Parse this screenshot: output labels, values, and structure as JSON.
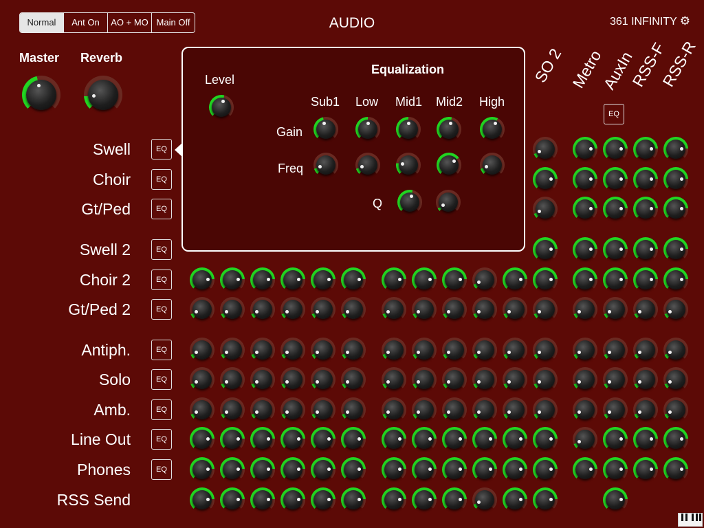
{
  "header": {
    "modes": [
      {
        "label": "Normal",
        "active": true
      },
      {
        "label": "Ant On",
        "active": false
      },
      {
        "label": "AO + MO",
        "active": false
      },
      {
        "label": "Main Off",
        "active": false
      }
    ],
    "title": "AUDIO",
    "device": "361 INFINITY",
    "settings_icon": "gear-icon"
  },
  "master": {
    "label": "Master"
  },
  "reverb": {
    "label": "Reverb"
  },
  "eq_label": "EQ",
  "rows": [
    {
      "label": "Swell"
    },
    {
      "label": "Choir"
    },
    {
      "label": "Gt/Ped"
    },
    {
      "label": "Swell 2"
    },
    {
      "label": "Choir 2"
    },
    {
      "label": "Gt/Ped 2"
    },
    {
      "label": "Antiph."
    },
    {
      "label": "Solo"
    },
    {
      "label": "Amb."
    },
    {
      "label": "Line Out"
    },
    {
      "label": "Phones"
    },
    {
      "label": "RSS Send"
    }
  ],
  "columns": [
    {
      "label": "SO 2"
    },
    {
      "label": "Metro"
    },
    {
      "label": "AuxIn"
    },
    {
      "label": "RSS-F"
    },
    {
      "label": "RSS-R"
    }
  ],
  "equalizer": {
    "title": "Equalization",
    "level_label": "Level",
    "bands": [
      "Sub1",
      "Low",
      "Mid1",
      "Mid2",
      "High"
    ],
    "gain_label": "Gain",
    "freq_label": "Freq",
    "q_label": "Q"
  },
  "piano_icon": "piano-keys-icon",
  "colors": {
    "background": "#5c0a06",
    "accent": "#22d622"
  }
}
